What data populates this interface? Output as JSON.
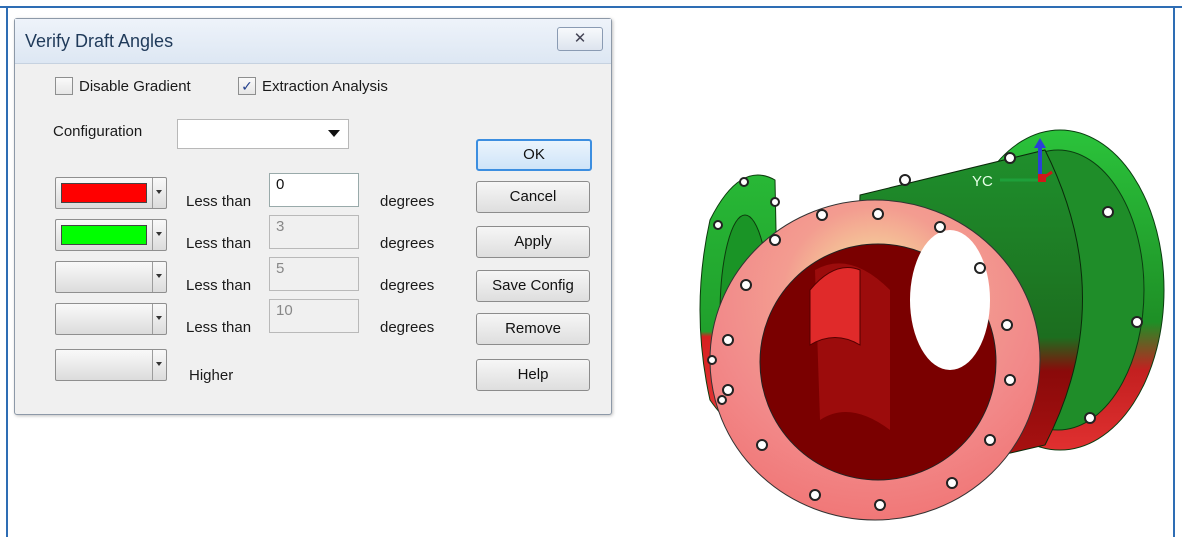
{
  "dialog": {
    "title": "Verify Draft Angles",
    "close_glyph": "✕",
    "disable_gradient": {
      "label": "Disable Gradient",
      "checked": false
    },
    "extraction_analysis": {
      "label": "Extraction Analysis",
      "checked": true
    },
    "configuration": {
      "label": "Configuration",
      "value": ""
    },
    "rows": [
      {
        "color": "#ff0000",
        "label": "Less than",
        "value": "0",
        "enabled": true,
        "unit": "degrees"
      },
      {
        "color": "#00ff00",
        "label": "Less than",
        "value": "3",
        "enabled": false,
        "unit": "degrees"
      },
      {
        "color": "",
        "label": "Less than",
        "value": "5",
        "enabled": false,
        "unit": "degrees"
      },
      {
        "color": "",
        "label": "Less than",
        "value": "10",
        "enabled": false,
        "unit": "degrees"
      },
      {
        "color": "",
        "label": "Higher"
      }
    ],
    "buttons": {
      "ok": "OK",
      "cancel": "Cancel",
      "apply": "Apply",
      "save_config": "Save Config",
      "remove": "Remove",
      "help": "Help"
    }
  },
  "viewport": {
    "axis_label": "YC",
    "colors": {
      "red": "#e42323",
      "green": "#22b534",
      "pale_red": "#f77d7d",
      "yellow": "#f3f08d",
      "dark_red": "#7a0000"
    }
  }
}
